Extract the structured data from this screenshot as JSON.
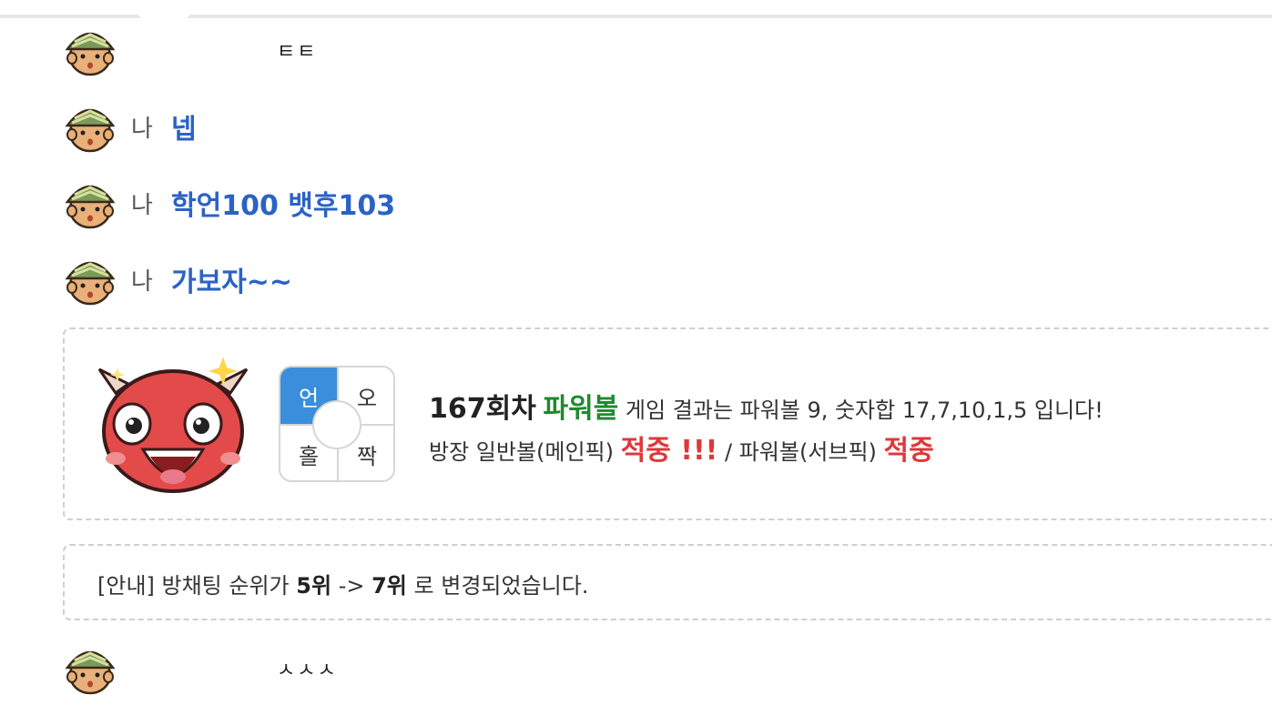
{
  "chat": {
    "messages": [
      {
        "sender_label": "",
        "text": "ㅌㅌ"
      },
      {
        "sender_label": "나",
        "text": "넵"
      },
      {
        "sender_label": "나",
        "text": "학언100 뱃후103"
      },
      {
        "sender_label": "나",
        "text": "가보자~~"
      },
      {
        "sender_label": "",
        "text": "ㅅㅅㅅ"
      }
    ]
  },
  "result": {
    "grid": {
      "top_left": "언",
      "top_right": "오",
      "bottom_left": "홀",
      "bottom_right": "짝"
    },
    "round": "167회차",
    "game": "파워볼",
    "summary": "게임 결과는 파워볼 9, 숫자합 17,7,10,1,5 입니다!",
    "line2_prefix": "방장 일반볼(메인픽)",
    "hit1": "적중 !!!",
    "line2_middle": "/ 파워볼(서브픽)",
    "hit2": "적중"
  },
  "notice": {
    "prefix": "[안내] 방채팅 순위가",
    "from_rank": "5위",
    "arrow": "->",
    "to_rank": "7위",
    "suffix": "로 변경되었습니다."
  },
  "colors": {
    "message_blue": "#2b62c6",
    "game_green": "#1f8a2f",
    "hit_red": "#e0373a",
    "selected_cell": "#3a8edb"
  },
  "icons": {
    "avatar": "soldier-avatar-icon",
    "devil": "red-devil-icon"
  }
}
